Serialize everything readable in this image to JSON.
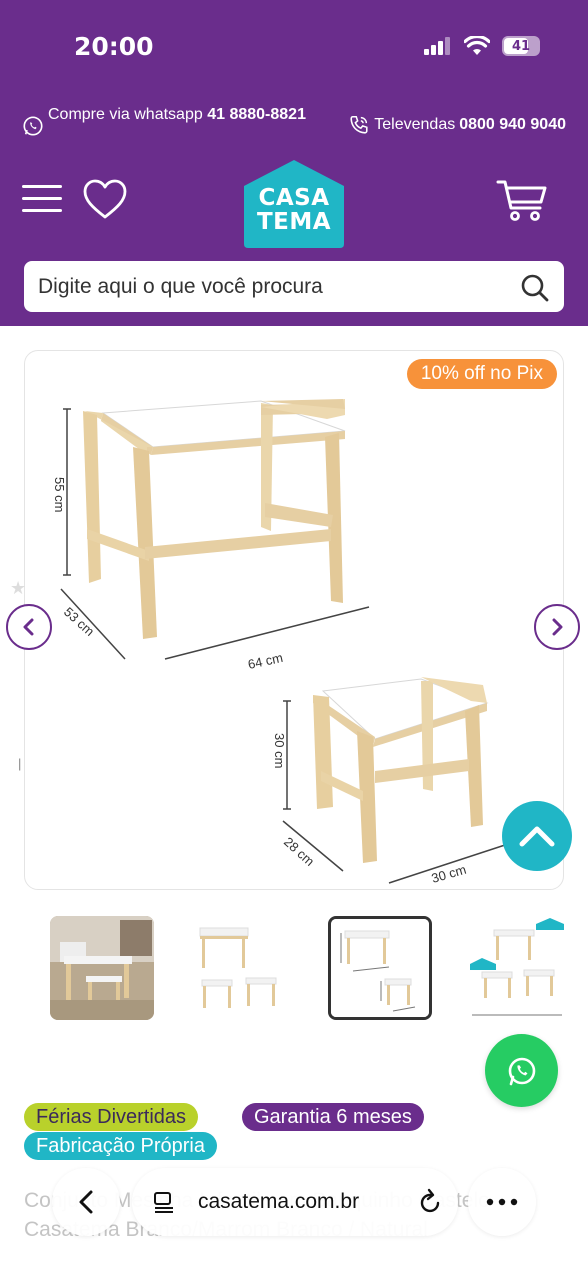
{
  "status_bar": {
    "time": "20:00",
    "battery": "41"
  },
  "header": {
    "whatsapp_text": "Compre via whatsapp",
    "whatsapp_number": "41 8880-8821",
    "televendas_text": "Televendas",
    "televendas_number": "0800 940 9040",
    "logo_line1": "CASA",
    "logo_line2": "TEMA"
  },
  "search": {
    "placeholder": "Digite aqui o que você procura"
  },
  "gallery": {
    "badge": "10% off no Pix",
    "dimensions": {
      "table_height": "55 cm",
      "table_depth": "53 cm",
      "table_width": "64 cm",
      "stool_height": "30 cm",
      "stool_depth": "28 cm",
      "stool_width": "30 cm"
    },
    "selected_thumbnail": 3
  },
  "tags": {
    "ferias": "Férias Divertidas",
    "garantia": "Garantia 6 meses",
    "fabricacao": "Fabricação Própria"
  },
  "product": {
    "title": "Conjunto Mesinha Infantil com Banquinho Castelo Casatema Branco/Marrom Branco / Natural"
  },
  "browser": {
    "url": "casatema.com.br"
  },
  "colors": {
    "brand_purple": "#6a2d8c",
    "accent_teal": "#20b6c6",
    "pix_orange": "#f7923a",
    "tag_green": "#b9d12b",
    "whatsapp_green": "#26cc63"
  }
}
